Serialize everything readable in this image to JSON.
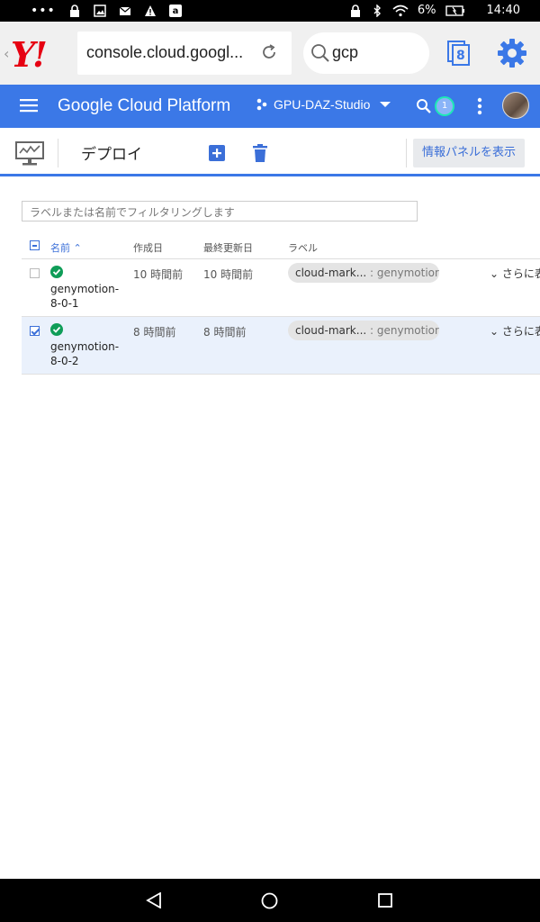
{
  "status_bar": {
    "time": "14:40",
    "battery": "6%",
    "left_icons": [
      "more-dots-icon",
      "lock-icon",
      "image-icon",
      "mail-icon",
      "warning-icon",
      "amazon-icon"
    ],
    "right_icons": [
      "lock-icon",
      "bluetooth-icon",
      "wifi-icon",
      "battery-icon"
    ]
  },
  "browser": {
    "logo": "Y!",
    "url": "console.cloud.googl...",
    "search_query": "gcp",
    "tab_count": "8"
  },
  "gcp_header": {
    "title": "Google Cloud Platform",
    "project": "GPU-DAZ-Studio",
    "notification_count": "1"
  },
  "toolbar": {
    "title": "デプロイ",
    "info_panel_label": "情報パネルを表示"
  },
  "filter": {
    "placeholder": "ラベルまたは名前でフィルタリングします"
  },
  "table": {
    "columns": {
      "name": "名前",
      "created": "作成日",
      "updated": "最終更新日",
      "labels": "ラベル"
    },
    "rows": [
      {
        "name_line1": "genymotion-",
        "name_line2": "8-0-1",
        "created": "10 時間前",
        "updated": "10 時間前",
        "label_key": "cloud-mark...",
        "label_value": ": genymotion...",
        "more": "さらに表",
        "selected": false
      },
      {
        "name_line1": "genymotion-",
        "name_line2": "8-0-2",
        "created": "8 時間前",
        "updated": "8 時間前",
        "label_key": "cloud-mark...",
        "label_value": ": genymotion...",
        "more": "さらに表",
        "selected": true
      }
    ]
  },
  "colors": {
    "gcp_blue": "#3b78e7",
    "link_blue": "#3b6fd8",
    "ok_green": "#0f9d58",
    "yahoo_red": "#e60012"
  }
}
